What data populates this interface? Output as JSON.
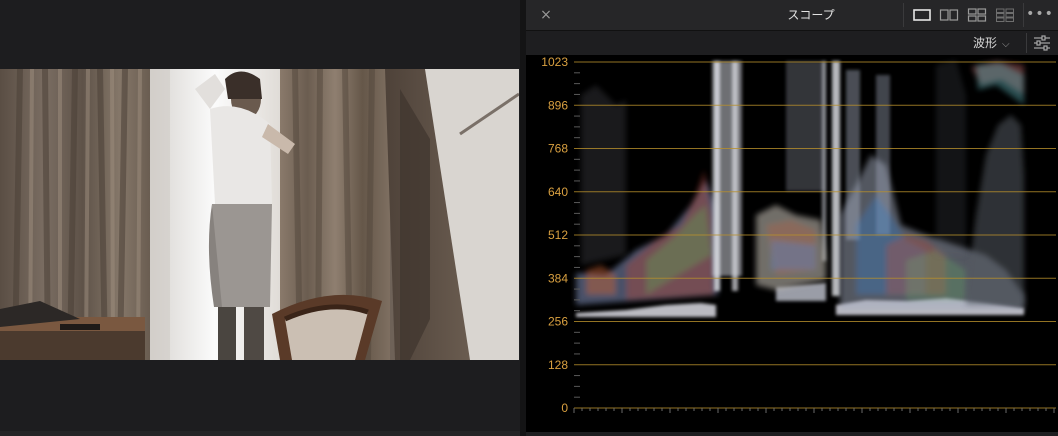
{
  "scope": {
    "title": "スコープ",
    "mode": "波形",
    "close_glyph": "×",
    "more_glyph": "•••",
    "axis_labels": [
      "1023",
      "896",
      "768",
      "640",
      "512",
      "384",
      "256",
      "128",
      "0"
    ]
  },
  "icons": {
    "close": "close-icon",
    "layout_single": "layout-single-icon",
    "layout_dual": "layout-dual-icon",
    "layout_quad": "layout-quad-icon",
    "layout_multi": "layout-multi-icon",
    "more": "more-icon",
    "settings": "sliders-icon",
    "chevron": "chevron-down-icon"
  },
  "colors": {
    "gridline": "#b8902c",
    "axis_label": "#d9a040",
    "panel_bg": "#1e1e20"
  }
}
